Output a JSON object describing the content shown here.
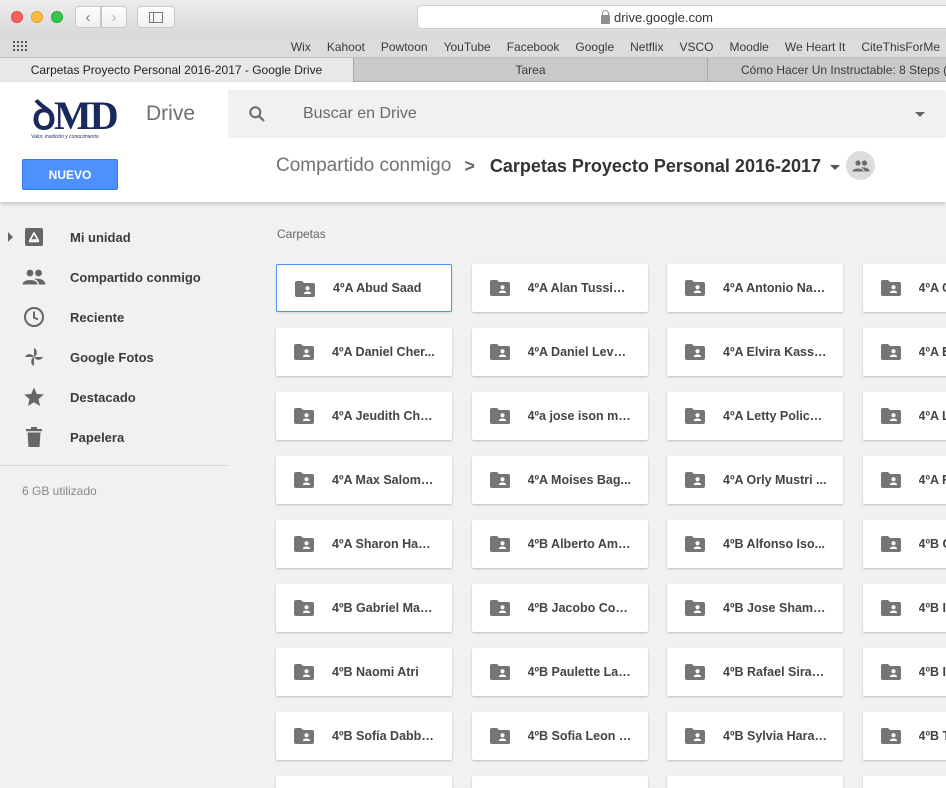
{
  "browser": {
    "url": "drive.google.com",
    "favorites": [
      "Wix",
      "Kahoot",
      "Powtoon",
      "YouTube",
      "Facebook",
      "Google",
      "Netflix",
      "VSCO",
      "Moodle",
      "We Heart It",
      "CiteThisForMe"
    ],
    "tabs": [
      {
        "label": "Carpetas Proyecto Personal 2016-2017 - Google Drive",
        "active": true
      },
      {
        "label": "Tarea",
        "active": false
      },
      {
        "label": "Cómo Hacer Un Instructable: 8 Steps (w",
        "active": false
      }
    ]
  },
  "header": {
    "logo": {
      "text": "ꝺMD",
      "tagline": "Valor, tradición y conocimiento"
    },
    "app_name": "Drive",
    "search_placeholder": "Buscar en Drive",
    "new_button": "NUEVO",
    "breadcrumb": {
      "parent": "Compartido conmigo",
      "separator": ">",
      "current": "Carpetas Proyecto Personal 2016-2017"
    }
  },
  "sidebar": {
    "items": [
      {
        "label": "Mi unidad",
        "icon": "drive-icon"
      },
      {
        "label": "Compartido conmigo",
        "icon": "people-icon"
      },
      {
        "label": "Reciente",
        "icon": "clock-icon"
      },
      {
        "label": "Google Fotos",
        "icon": "pinwheel-icon"
      },
      {
        "label": "Destacado",
        "icon": "star-icon"
      },
      {
        "label": "Papelera",
        "icon": "trash-icon"
      }
    ],
    "storage": "6 GB utilizado"
  },
  "main": {
    "section_title": "Carpetas",
    "folders": [
      "4ºA Abud Saad",
      "4ºA Alan Tussie ...",
      "4ºA Antonio Nak...",
      "4ºA C",
      "4ºA Daniel Cher...",
      "4ºA Daniel Levy ...",
      "4ºA Elvira Kassi...",
      "4ºA E",
      "4ºA Jeudith Cha...",
      "4ºa jose ison mi...",
      "4ºA Letty Polica...",
      "4ºA L",
      "4ºA Max Salomo...",
      "4ºA Moises Bag...",
      "4ºA Orly Mustri ...",
      "4ºA F",
      "4ºA Sharon Ham...",
      "4ºB Alberto Ami...",
      "4ºB Alfonso Iso...",
      "4ºB C",
      "4ºB Gabriel Mas...",
      "4ºB Jacobo Coh...",
      "4ºB Jose Shamo...",
      "4ºB I",
      "4ºB Naomi Atri",
      "4ºB Paulette Lan...",
      "4ºB Rafael Sirazi...",
      "4ºB I",
      "4ºB Sofía Dabba...",
      "4ºB Sofia Leon J...",
      "4ºB Sylvia Harar...",
      "4ºB T",
      "",
      "",
      "",
      ""
    ]
  }
}
